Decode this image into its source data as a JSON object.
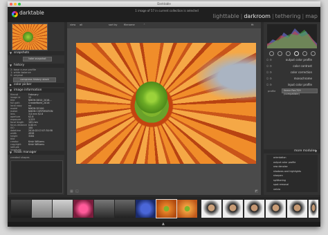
{
  "window": {
    "title": "Darktable"
  },
  "header": {
    "app_name": "darktable",
    "status": "1 image of 57 in current collection is selected",
    "views": [
      "lighttable",
      "darkroom",
      "tethering",
      "map"
    ],
    "active_view": "darkroom"
  },
  "left_panel": {
    "snapshots": {
      "title": "snapshots",
      "button": "take snapshot"
    },
    "history": {
      "title": "history",
      "items": [
        "2: base curve profile",
        "1: white balance",
        "0: original"
      ],
      "compress_button": "compress history stack"
    },
    "color_picker": {
      "title": "color picker"
    },
    "image_information": {
      "title": "image information",
      "labels": [
        "filmroll",
        "image id",
        "title",
        "full path",
        "local copy",
        "model",
        "maker",
        "lens",
        "aperture",
        "exposure",
        "focal length",
        "focus distance",
        "ISO",
        "datetime",
        "width",
        "height",
        "title",
        "creator",
        "copyright",
        "latitude",
        "longitude"
      ],
      "values": [
        "February",
        "12",
        "NIKON D810_2016...",
        "CreateWorld_2016",
        "no",
        "NIKON D5100",
        "NIKON CORPORATION",
        "3.0 mm f/2.8",
        "f/2.8",
        "1/125",
        "105 mm",
        "0.00 m",
        "100",
        "2014:02:13 07:30:58",
        "4928",
        "3264",
        "",
        "Krish Williams",
        "Krish Williams",
        "",
        ""
      ]
    },
    "mask_manager": {
      "title": "mask manager",
      "field": "created shapes"
    }
  },
  "center": {
    "toolbar": {
      "view": "view",
      "view_value": "all",
      "sort_by": "sort by",
      "sort_value": "filename",
      "zoom": "fit"
    }
  },
  "right_panel": {
    "modules": [
      {
        "name": "output color profile"
      },
      {
        "name": "color contrast"
      },
      {
        "name": "color correction"
      },
      {
        "name": "monochrome"
      },
      {
        "name": "input color profile"
      }
    ],
    "input_profile": {
      "label": "profile",
      "value": "linear Rec709 (compatible)"
    },
    "more_modules": {
      "title": "more modules",
      "items": [
        "orientation",
        "output color profile",
        "raw denoise",
        "shadows and highlights",
        "sharpen",
        "splittoning",
        "spot removal",
        "velvia"
      ]
    }
  },
  "colors": {
    "accent": "#e8e8e8",
    "panel": "#333333",
    "bg": "#2b2b2b"
  }
}
